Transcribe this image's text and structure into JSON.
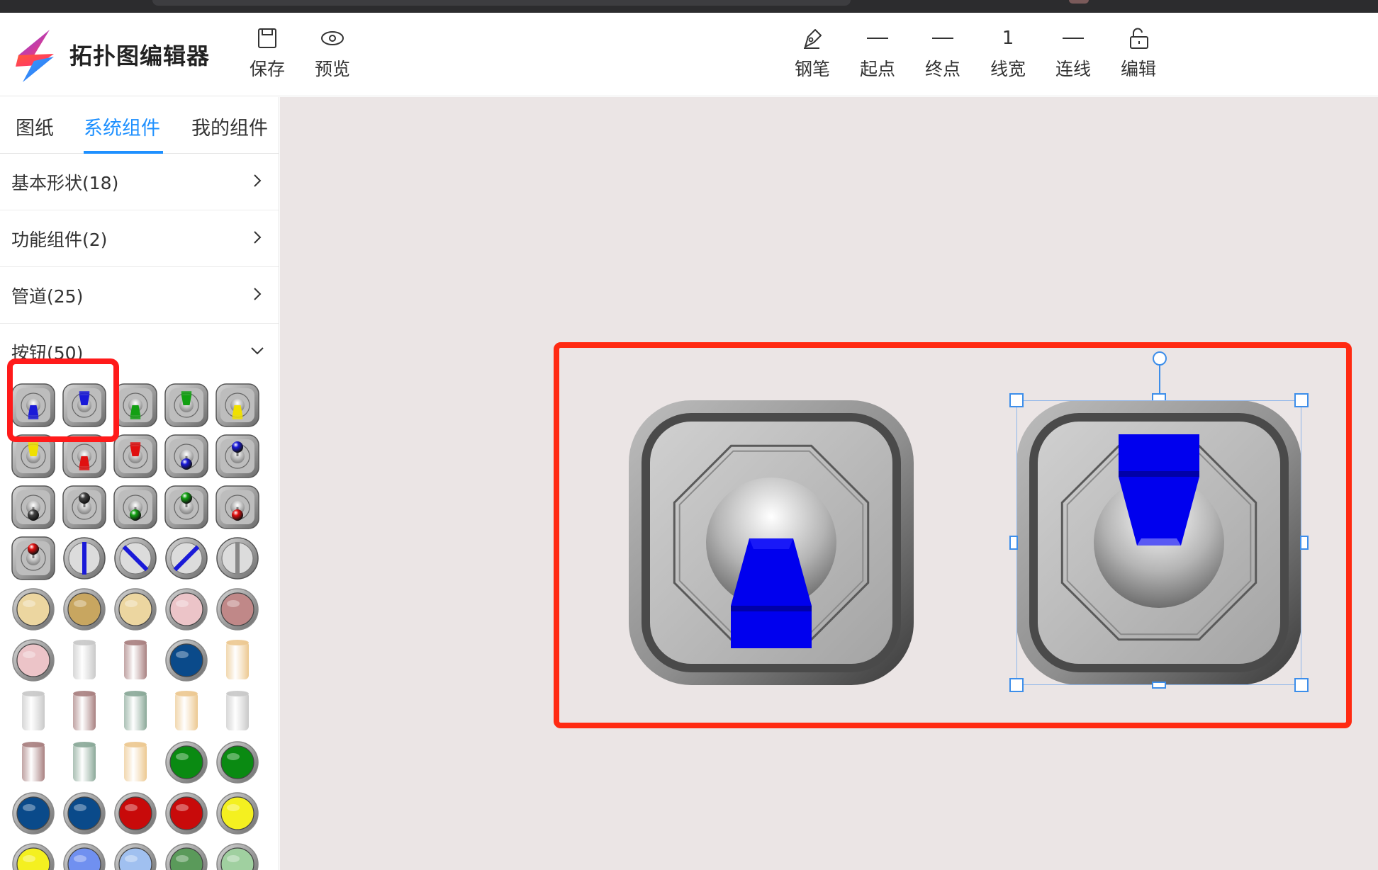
{
  "app": {
    "title": "拓扑图编辑器"
  },
  "toolbar_left": {
    "save_label": "保存",
    "preview_label": "预览"
  },
  "toolbar_right": {
    "pen_label": "钢笔",
    "start_label": "起点",
    "end_label": "终点",
    "line_width_value": "1",
    "line_width_label": "线宽",
    "connect_label": "连线",
    "edit_label": "编辑"
  },
  "sidebar": {
    "tabs": [
      {
        "label": "图纸"
      },
      {
        "label": "系统组件",
        "active": true
      },
      {
        "label": "我的组件"
      }
    ],
    "categories": [
      {
        "label": "基本形状(18)",
        "expanded": false
      },
      {
        "label": "功能组件(2)",
        "expanded": false
      },
      {
        "label": "管道(25)",
        "expanded": false
      },
      {
        "label": "按钮(50)",
        "expanded": true
      }
    ]
  },
  "palette": {
    "rows": [
      [
        {
          "type": "toggle",
          "color": "#1a1ad8",
          "dir": "down"
        },
        {
          "type": "toggle",
          "color": "#1a1ad8",
          "dir": "up"
        },
        {
          "type": "toggle",
          "color": "#12a012",
          "dir": "down"
        },
        {
          "type": "toggle",
          "color": "#12a012",
          "dir": "up"
        },
        {
          "type": "toggle",
          "color": "#f0e000",
          "dir": "down"
        }
      ],
      [
        {
          "type": "toggle",
          "color": "#f0e000",
          "dir": "up"
        },
        {
          "type": "toggle",
          "color": "#e01010",
          "dir": "down"
        },
        {
          "type": "toggle",
          "color": "#e01010",
          "dir": "up"
        },
        {
          "type": "ball",
          "color": "#1a1ad8",
          "dir": "down"
        },
        {
          "type": "ball",
          "color": "#1a1ad8",
          "dir": "up"
        }
      ],
      [
        {
          "type": "ball",
          "color": "#444444",
          "dir": "down"
        },
        {
          "type": "ball",
          "color": "#444444",
          "dir": "up"
        },
        {
          "type": "ball",
          "color": "#12a012",
          "dir": "down"
        },
        {
          "type": "ball",
          "color": "#12a012",
          "dir": "up"
        },
        {
          "type": "ball",
          "color": "#e01010",
          "dir": "down"
        }
      ],
      [
        {
          "type": "ball",
          "color": "#e01010",
          "dir": "up"
        },
        {
          "type": "dial",
          "color": "#1a1ad8",
          "angle": 0
        },
        {
          "type": "dial",
          "color": "#1a1ad8",
          "angle": -45
        },
        {
          "type": "dial",
          "color": "#1a1ad8",
          "angle": 45
        },
        {
          "type": "dial",
          "color": "#888888",
          "angle": 0
        }
      ],
      [
        {
          "type": "round",
          "color": "#ecd6a0"
        },
        {
          "type": "round",
          "color": "#c8a660"
        },
        {
          "type": "round",
          "color": "#ecd6a0"
        },
        {
          "type": "round",
          "color": "#ecc4c8"
        },
        {
          "type": "round",
          "color": "#c08888"
        }
      ],
      [
        {
          "type": "round",
          "color": "#ecc4c8"
        },
        {
          "type": "cyl",
          "color": "#c8c8c8"
        },
        {
          "type": "cyl",
          "color": "#a88080"
        },
        {
          "type": "round",
          "color": "#0a4a8a"
        },
        {
          "type": "cyl",
          "color": "#ecc890"
        }
      ],
      [
        {
          "type": "cyl",
          "color": "#c8c8c8"
        },
        {
          "type": "cyl",
          "color": "#a88080"
        },
        {
          "type": "cyl",
          "color": "#8aa898"
        },
        {
          "type": "cyl",
          "color": "#ecc890"
        },
        {
          "type": "cyl",
          "color": "#c8c8c8"
        }
      ],
      [
        {
          "type": "cyl",
          "color": "#a88080"
        },
        {
          "type": "cyl",
          "color": "#8aa898"
        },
        {
          "type": "cyl",
          "color": "#ecc890"
        },
        {
          "type": "round",
          "color": "#0a8a12"
        },
        {
          "type": "round",
          "color": "#0a8a12"
        }
      ],
      [
        {
          "type": "round",
          "color": "#0a4a8a"
        },
        {
          "type": "round",
          "color": "#0a4a8a"
        },
        {
          "type": "round",
          "color": "#c80a0a"
        },
        {
          "type": "round",
          "color": "#c80a0a"
        },
        {
          "type": "round",
          "color": "#f4f020"
        }
      ],
      [
        {
          "type": "round",
          "color": "#f4f020"
        },
        {
          "type": "round",
          "color": "#7090f0"
        },
        {
          "type": "round",
          "color": "#a0c0f0"
        },
        {
          "type": "round",
          "color": "#5a9a5a"
        },
        {
          "type": "round",
          "color": "#a0d0a0"
        }
      ]
    ]
  },
  "canvas": {
    "components": [
      {
        "name": "toggle-switch-down",
        "color": "#0000ee",
        "dir": "down",
        "selected": false
      },
      {
        "name": "toggle-switch-up",
        "color": "#0000ee",
        "dir": "up",
        "selected": true
      }
    ]
  },
  "colors": {
    "accent": "#1e90ff",
    "annotation_red": "#ff2a12",
    "canvas_bg": "#ebe5e5",
    "selection_blue": "#3d8eea"
  },
  "icons": {
    "logo": "lightning-logo-icon",
    "save": "floppy-disk-icon",
    "preview": "eye-icon",
    "pen": "pen-nib-icon",
    "start": "line-start-icon",
    "end": "line-end-icon",
    "connect": "connector-line-icon",
    "edit": "unlock-icon"
  }
}
